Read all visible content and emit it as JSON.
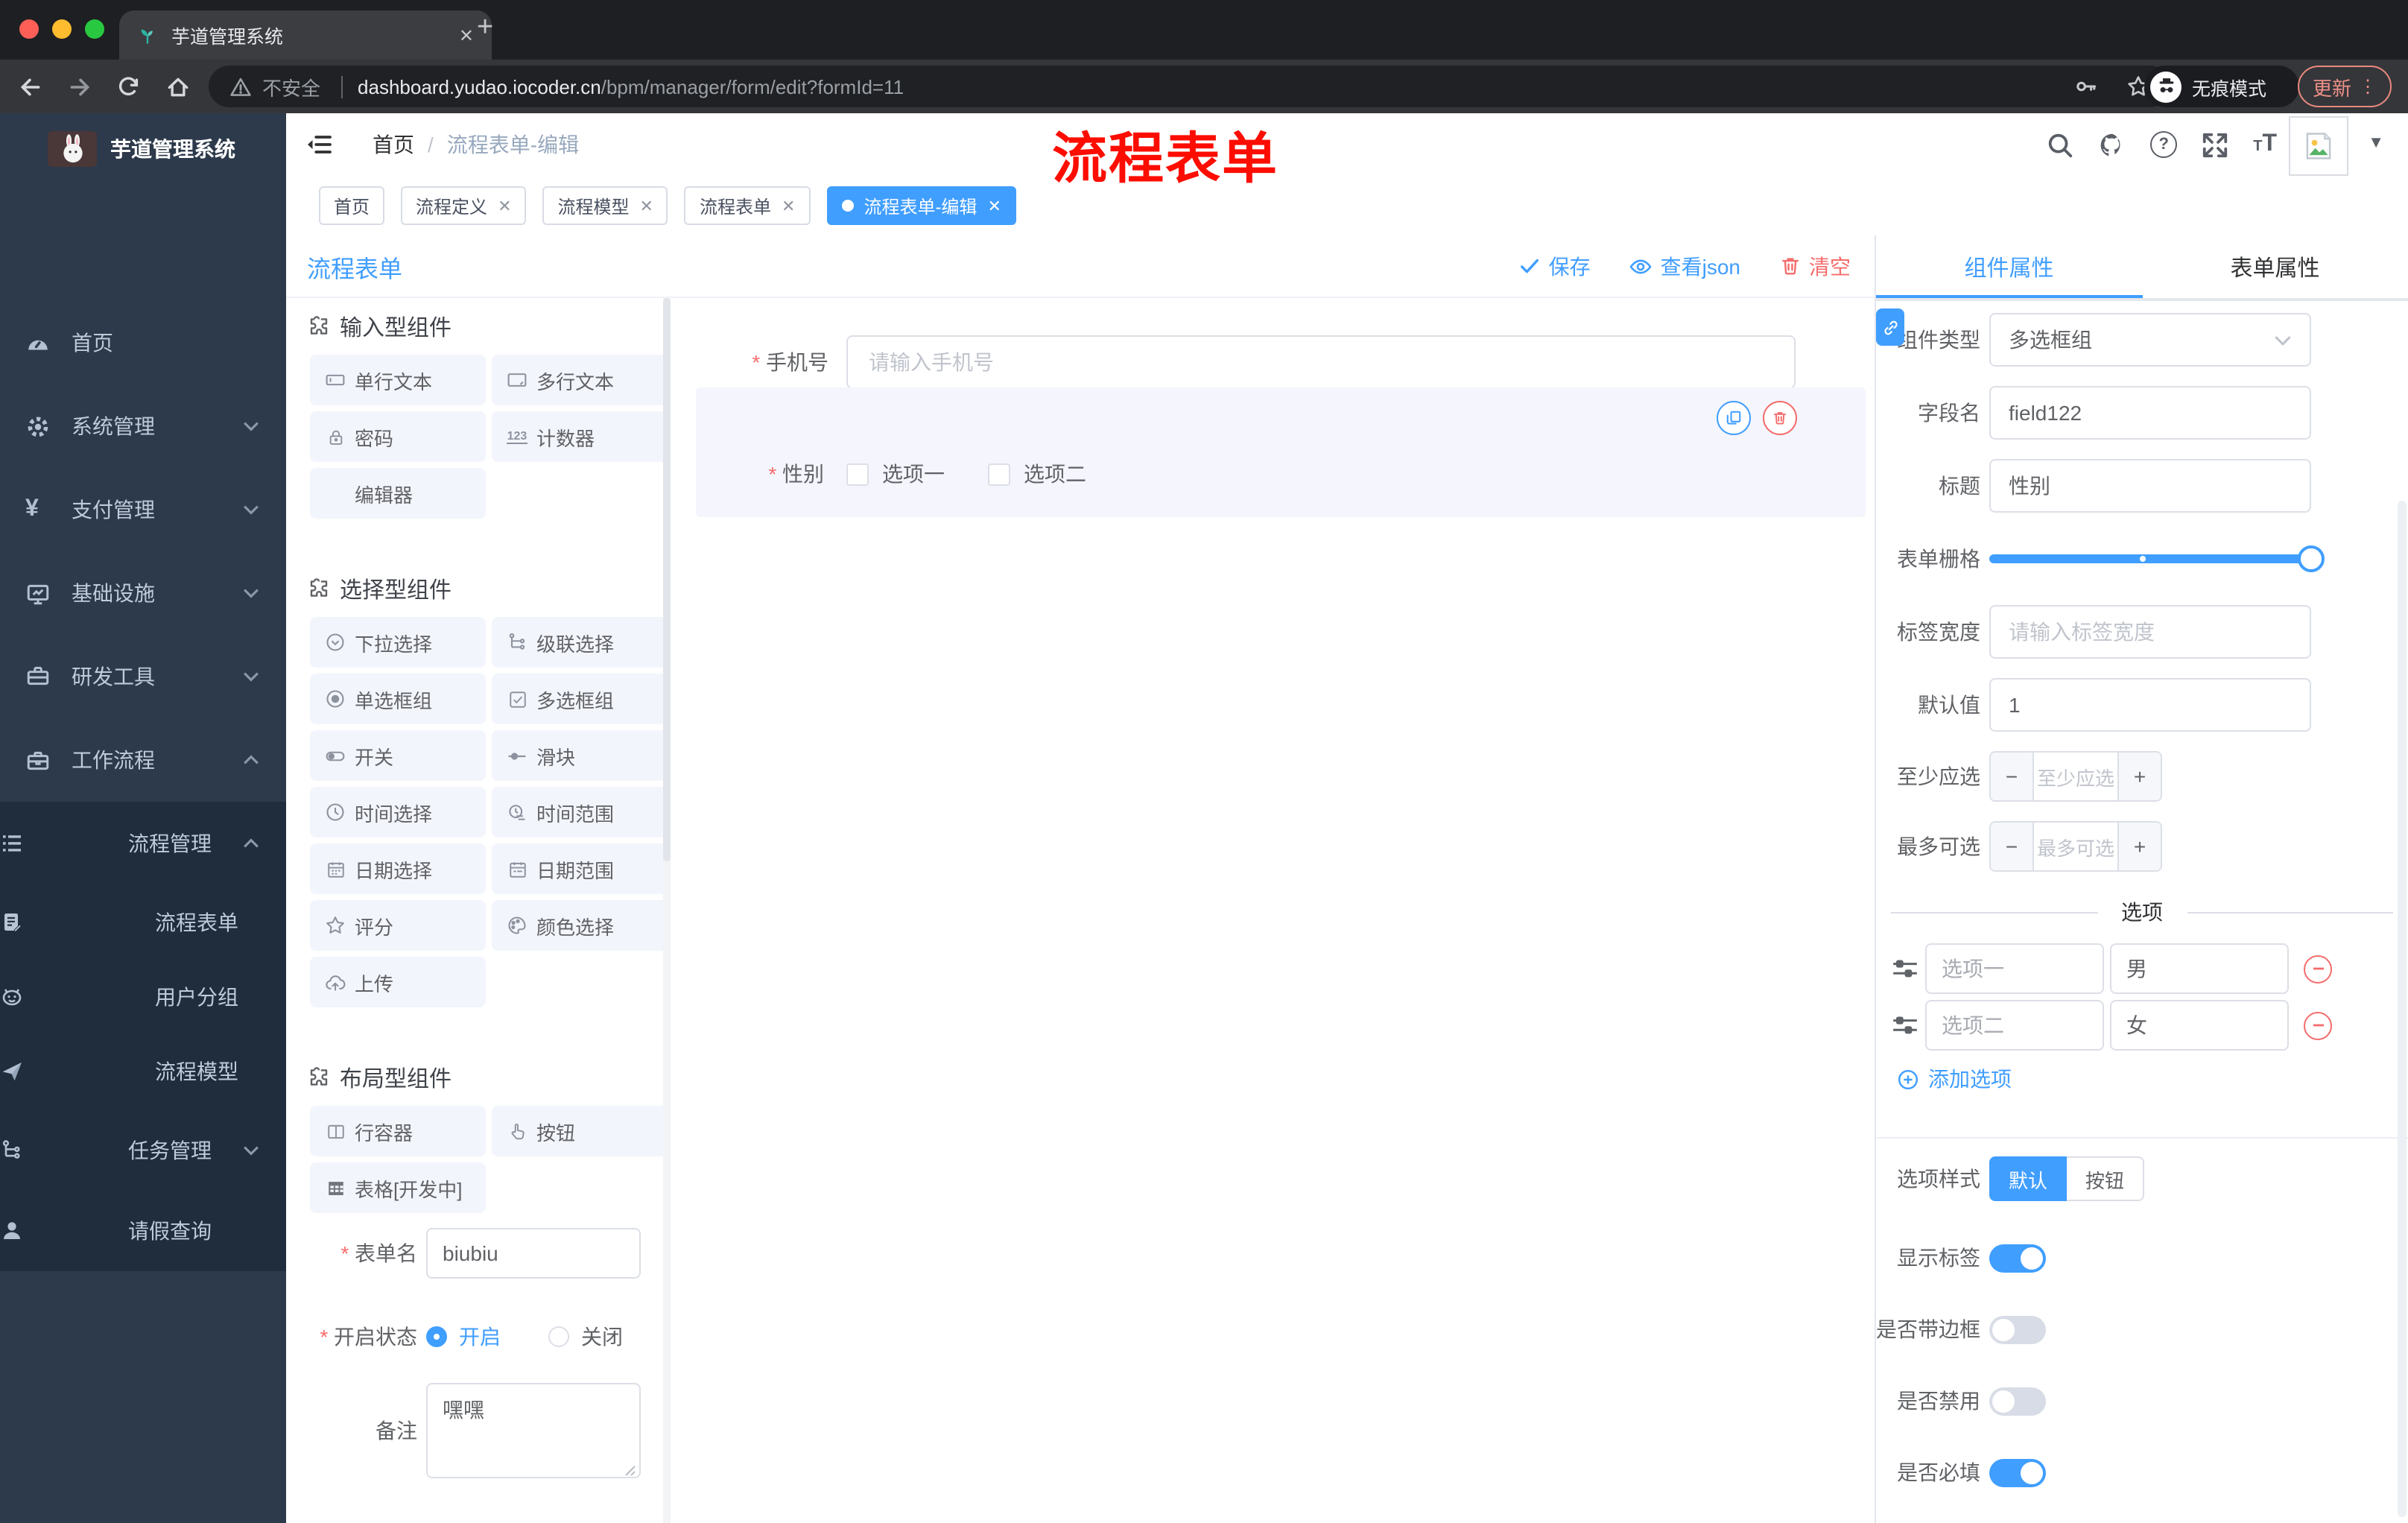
{
  "browser": {
    "tab_title": "芋道管理系统",
    "security_label": "不安全",
    "url_host": "dashboard.yudao.iocoder.cn",
    "url_path": "/bpm/manager/form/edit?formId=11",
    "incognito_label": "无痕模式",
    "update_label": "更新"
  },
  "sidebar": {
    "app_title": "芋道管理系统",
    "items": [
      {
        "label": "首页"
      },
      {
        "label": "系统管理"
      },
      {
        "label": "支付管理"
      },
      {
        "label": "基础设施"
      },
      {
        "label": "研发工具"
      },
      {
        "label": "工作流程"
      },
      {
        "label": "流程管理"
      },
      {
        "label": "流程表单"
      },
      {
        "label": "用户分组"
      },
      {
        "label": "流程模型"
      },
      {
        "label": "任务管理"
      },
      {
        "label": "请假查询"
      }
    ]
  },
  "header": {
    "breadcrumb_home": "首页",
    "breadcrumb_sep": "/",
    "breadcrumb_current": "流程表单-编辑",
    "annotation": "流程表单"
  },
  "tags": [
    {
      "label": "首页",
      "closable": false,
      "active": false
    },
    {
      "label": "流程定义",
      "closable": true,
      "active": false
    },
    {
      "label": "流程模型",
      "closable": true,
      "active": false
    },
    {
      "label": "流程表单",
      "closable": true,
      "active": false
    },
    {
      "label": "流程表单-编辑",
      "closable": true,
      "active": true
    }
  ],
  "designer": {
    "title": "流程表单",
    "save_label": "保存",
    "view_json_label": "查看json",
    "clear_label": "清空"
  },
  "components": {
    "sections": [
      {
        "title": "输入型组件",
        "items": [
          "单行文本",
          "多行文本",
          "密码",
          "计数器",
          "编辑器"
        ]
      },
      {
        "title": "选择型组件",
        "items": [
          "下拉选择",
          "级联选择",
          "单选框组",
          "多选框组",
          "开关",
          "滑块",
          "时间选择",
          "时间范围",
          "日期选择",
          "日期范围",
          "评分",
          "颜色选择",
          "上传"
        ]
      },
      {
        "title": "布局型组件",
        "items": [
          "行容器",
          "按钮",
          "表格[开发中]"
        ]
      }
    ]
  },
  "meta_form": {
    "name_label": "表单名",
    "name_value": "biubiu",
    "status_label": "开启状态",
    "status_on": "开启",
    "status_off": "关闭",
    "remark_label": "备注",
    "remark_value": "嘿嘿"
  },
  "canvas": {
    "phone_label": "手机号",
    "phone_placeholder": "请输入手机号",
    "gender_label": "性别",
    "gender_options": [
      "选项一",
      "选项二"
    ]
  },
  "props": {
    "tab_component": "组件属性",
    "tab_form": "表单属性",
    "rows": {
      "type_label": "组件类型",
      "type_value": "多选框组",
      "field_label": "字段名",
      "field_value": "field122",
      "title_label": "标题",
      "title_value": "性别",
      "grid_label": "表单栅格",
      "labelwidth_label": "标签宽度",
      "labelwidth_placeholder": "请输入标签宽度",
      "default_label": "默认值",
      "default_value": "1",
      "min_label": "至少应选",
      "min_placeholder": "至少应选",
      "max_label": "最多可选",
      "max_placeholder": "最多可选"
    },
    "options_divider": "选项",
    "options": [
      {
        "label": "选项一",
        "value": "男"
      },
      {
        "label": "选项二",
        "value": "女"
      }
    ],
    "add_option_label": "添加选项",
    "style_label": "选项样式",
    "style_default": "默认",
    "style_button": "按钮",
    "toggles": [
      {
        "label": "显示标签",
        "on": true
      },
      {
        "label": "是否带边框",
        "on": false
      },
      {
        "label": "是否禁用",
        "on": false
      },
      {
        "label": "是否必填",
        "on": true
      }
    ]
  },
  "colors": {
    "accent": "#409eff",
    "danger": "#f56c6c",
    "annotation": "#ff0000"
  }
}
